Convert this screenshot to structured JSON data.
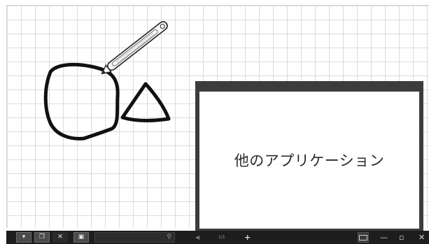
{
  "app_window": {
    "body_text": "他のアプリケーション"
  },
  "toolbar": {
    "search_icon": "magnifier-icon",
    "page_indicator": "1/1",
    "add_page_glyph": "+",
    "minimize_glyph": "—",
    "restore_glyph": "▫",
    "close_glyph": "✕",
    "tools_glyph": "✕",
    "pen_glyph": "▾",
    "copy_glyph": "❐",
    "select_glyph": "▣",
    "search_glyph": "⚲",
    "prev_glyph": "◀"
  },
  "colors": {
    "grid": "#dcdcdc",
    "toolbar": "#1d1d1d",
    "window_frame": "#3c3c3c",
    "ink": "#111111"
  }
}
